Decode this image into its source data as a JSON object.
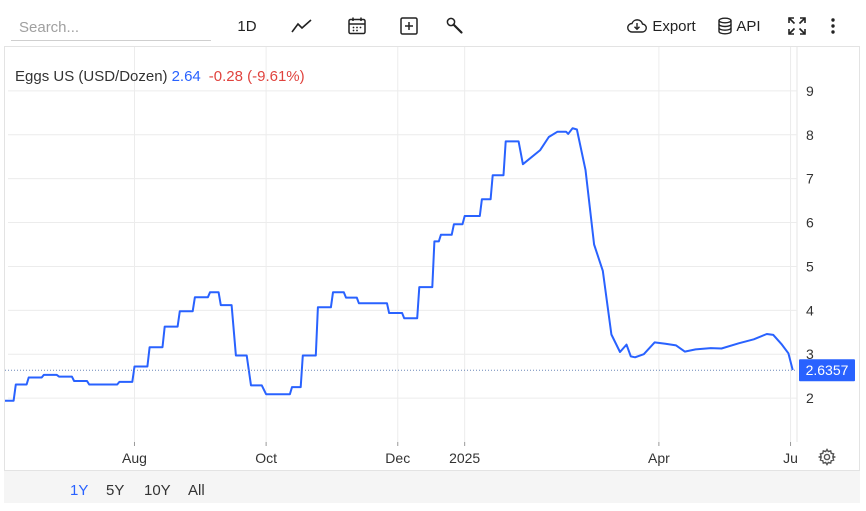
{
  "toolbar": {
    "search_placeholder": "Search...",
    "interval_label": "1D",
    "export_label": "Export",
    "api_label": "API"
  },
  "legend": {
    "name": "Eggs US (USD/Dozen)",
    "last": "2.64",
    "change": "-0.28 (-9.61%)"
  },
  "ranges": [
    "1Y",
    "5Y",
    "10Y",
    "All"
  ],
  "active_range": "1Y",
  "colors": {
    "line": "#2962ff",
    "negative": "#e0433e",
    "price_tag": "#2962ff"
  },
  "chart_data": {
    "type": "line",
    "title": "",
    "xlabel": "",
    "ylabel": "",
    "ylim": [
      1.0,
      10.0
    ],
    "y_ticks": [
      "2",
      "3",
      "4",
      "5",
      "6",
      "7",
      "8",
      "9"
    ],
    "x_ticks": [
      "Aug",
      "Oct",
      "Dec",
      "2025",
      "Apr",
      "Ju"
    ],
    "x_range": [
      "2024-06-02",
      "2025-06-04"
    ],
    "last_price_label": "2.6357",
    "grid": true,
    "series": [
      {
        "name": "Eggs US (USD/Dozen)",
        "points": [
          [
            "2024-06-02",
            1.94
          ],
          [
            "2024-06-06",
            1.94
          ],
          [
            "2024-06-07",
            2.31
          ],
          [
            "2024-06-12",
            2.31
          ],
          [
            "2024-06-13",
            2.47
          ],
          [
            "2024-06-19",
            2.47
          ],
          [
            "2024-06-20",
            2.53
          ],
          [
            "2024-06-26",
            2.53
          ],
          [
            "2024-06-27",
            2.49
          ],
          [
            "2024-07-03",
            2.49
          ],
          [
            "2024-07-04",
            2.39
          ],
          [
            "2024-07-10",
            2.39
          ],
          [
            "2024-07-11",
            2.31
          ],
          [
            "2024-07-24",
            2.31
          ],
          [
            "2024-07-25",
            2.37
          ],
          [
            "2024-07-31",
            2.37
          ],
          [
            "2024-08-01",
            2.72
          ],
          [
            "2024-08-07",
            2.72
          ],
          [
            "2024-08-08",
            3.16
          ],
          [
            "2024-08-14",
            3.16
          ],
          [
            "2024-08-15",
            3.63
          ],
          [
            "2024-08-21",
            3.63
          ],
          [
            "2024-08-22",
            3.98
          ],
          [
            "2024-08-28",
            3.98
          ],
          [
            "2024-08-29",
            4.3
          ],
          [
            "2024-09-04",
            4.3
          ],
          [
            "2024-09-05",
            4.41
          ],
          [
            "2024-09-09",
            4.41
          ],
          [
            "2024-09-10",
            4.12
          ],
          [
            "2024-09-15",
            4.12
          ],
          [
            "2024-09-17",
            2.97
          ],
          [
            "2024-09-22",
            2.97
          ],
          [
            "2024-09-24",
            2.29
          ],
          [
            "2024-09-29",
            2.29
          ],
          [
            "2024-10-01",
            2.09
          ],
          [
            "2024-10-12",
            2.09
          ],
          [
            "2024-10-13",
            2.25
          ],
          [
            "2024-10-17",
            2.25
          ],
          [
            "2024-10-18",
            2.97
          ],
          [
            "2024-10-24",
            2.97
          ],
          [
            "2024-10-25",
            4.07
          ],
          [
            "2024-10-31",
            4.07
          ],
          [
            "2024-11-01",
            4.41
          ],
          [
            "2024-11-06",
            4.41
          ],
          [
            "2024-11-07",
            4.29
          ],
          [
            "2024-11-12",
            4.29
          ],
          [
            "2024-11-13",
            4.16
          ],
          [
            "2024-11-26",
            4.16
          ],
          [
            "2024-11-27",
            3.94
          ],
          [
            "2024-12-03",
            3.94
          ],
          [
            "2024-12-04",
            3.82
          ],
          [
            "2024-12-10",
            3.82
          ],
          [
            "2024-12-11",
            4.53
          ],
          [
            "2024-12-17",
            4.53
          ],
          [
            "2024-12-18",
            5.57
          ],
          [
            "2024-12-20",
            5.57
          ],
          [
            "2024-12-21",
            5.72
          ],
          [
            "2024-12-26",
            5.72
          ],
          [
            "2024-12-27",
            5.96
          ],
          [
            "2024-12-31",
            5.96
          ],
          [
            "2025-01-01",
            6.15
          ],
          [
            "2025-01-08",
            6.15
          ],
          [
            "2025-01-09",
            6.53
          ],
          [
            "2025-01-13",
            6.53
          ],
          [
            "2025-01-14",
            7.08
          ],
          [
            "2025-01-19",
            7.08
          ],
          [
            "2025-01-20",
            7.85
          ],
          [
            "2025-01-26",
            7.85
          ],
          [
            "2025-01-28",
            7.33
          ],
          [
            "2025-02-05",
            7.65
          ],
          [
            "2025-02-09",
            7.95
          ],
          [
            "2025-02-13",
            8.07
          ],
          [
            "2025-02-17",
            8.07
          ],
          [
            "2025-02-18",
            8.02
          ],
          [
            "2025-02-20",
            8.15
          ],
          [
            "2025-02-22",
            8.12
          ],
          [
            "2025-02-26",
            7.2
          ],
          [
            "2025-03-02",
            5.5
          ],
          [
            "2025-03-06",
            4.9
          ],
          [
            "2025-03-10",
            3.45
          ],
          [
            "2025-03-14",
            3.05
          ],
          [
            "2025-03-17",
            3.22
          ],
          [
            "2025-03-19",
            2.95
          ],
          [
            "2025-03-21",
            2.93
          ],
          [
            "2025-03-25",
            3.0
          ],
          [
            "2025-03-30",
            3.27
          ],
          [
            "2025-04-04",
            3.24
          ],
          [
            "2025-04-09",
            3.2
          ],
          [
            "2025-04-13",
            3.06
          ],
          [
            "2025-04-18",
            3.11
          ],
          [
            "2025-04-25",
            3.14
          ],
          [
            "2025-04-30",
            3.13
          ],
          [
            "2025-05-08",
            3.25
          ],
          [
            "2025-05-15",
            3.34
          ],
          [
            "2025-05-21",
            3.46
          ],
          [
            "2025-05-24",
            3.44
          ],
          [
            "2025-05-28",
            3.22
          ],
          [
            "2025-05-31",
            3.02
          ],
          [
            "2025-06-02",
            2.64
          ]
        ]
      }
    ]
  }
}
